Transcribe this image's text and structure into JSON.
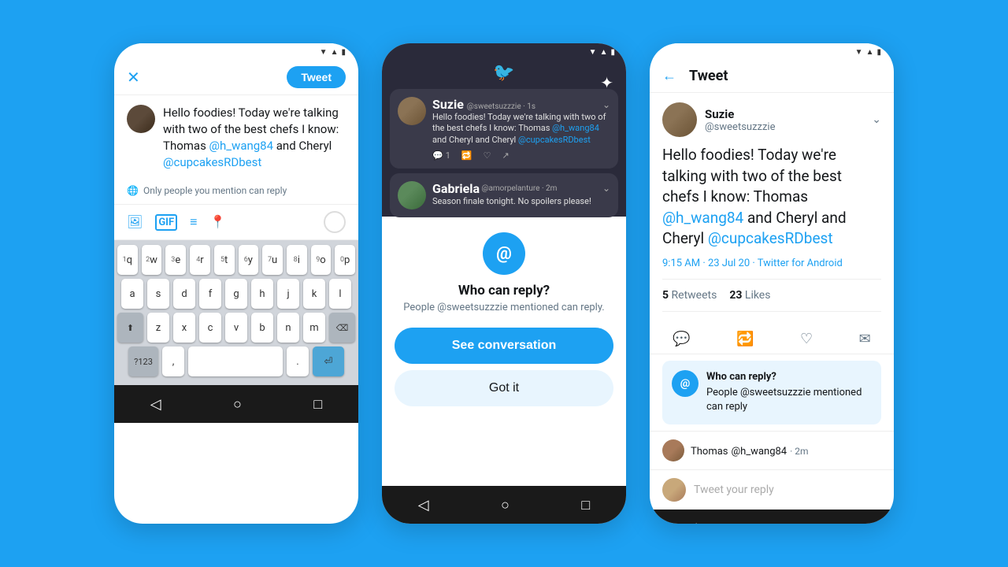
{
  "background_color": "#1da1f2",
  "phone1": {
    "close_label": "✕",
    "tweet_button": "Tweet",
    "compose_text_before": "Hello foodies! Today we're talking with two of the best chefs I know: Thomas ",
    "compose_mention1": "@h_wang84",
    "compose_text_mid": " and Cheryl ",
    "compose_mention2": "@cupcakesRDbest",
    "reply_notice": "Only people you mention can reply",
    "keyboard": {
      "row1": [
        "q",
        "w",
        "e",
        "r",
        "t",
        "y",
        "u",
        "i",
        "o",
        "p"
      ],
      "row2": [
        "a",
        "s",
        "d",
        "f",
        "g",
        "h",
        "j",
        "k",
        "l"
      ],
      "row3": [
        "z",
        "x",
        "c",
        "v",
        "b",
        "n",
        "m"
      ],
      "bottom": [
        "?123",
        ",",
        ".",
        "⏎"
      ]
    }
  },
  "phone2": {
    "tweet_card": {
      "user": "Suzie",
      "handle": "@sweetsuzzzie",
      "time": "1s",
      "text_before": "Hello foodies! Today we're talking with two of the best chefs I know: Thomas ",
      "mention1": "@h_wang84",
      "text_mid": " and Cheryl ",
      "mention2": "@cupcakesRDbest",
      "reply_count": "1",
      "chevron": "⌄"
    },
    "gabriela_card": {
      "user": "Gabriela",
      "handle": "@amorpelanture",
      "time": "2m",
      "text": "Season finale tonight. No spoilers please!"
    },
    "sheet": {
      "at_symbol": "@",
      "title": "Who can reply?",
      "subtitle": "People @sweetsuzzzie mentioned can reply.",
      "see_conversation": "See conversation",
      "got_it": "Got it"
    }
  },
  "phone3": {
    "back_label": "←",
    "title": "Tweet",
    "author": {
      "name": "Suzie",
      "handle": "@sweetsuzzzie"
    },
    "tweet_body_before": "Hello foodies! Today we're talking with two of the best chefs I know: Thomas ",
    "mention1": "@h_wang84",
    "tweet_body_mid": " and Cheryl ",
    "mention2": "@cupcakesRDbest",
    "meta": {
      "time": "9:15 AM · 23 Jul 20 · ",
      "source": "Twitter for Android"
    },
    "stats": {
      "retweets_count": "5",
      "retweets_label": "Retweets",
      "likes_count": "23",
      "likes_label": "Likes"
    },
    "who_can_reply": {
      "at_symbol": "@",
      "title": "Who can reply?",
      "body": "People @sweetsuzzzie mentioned can reply"
    },
    "reply_row": {
      "user": "Thomas",
      "handle": "@h_wang84",
      "time": "2m"
    },
    "reply_placeholder": "Tweet your reply"
  }
}
